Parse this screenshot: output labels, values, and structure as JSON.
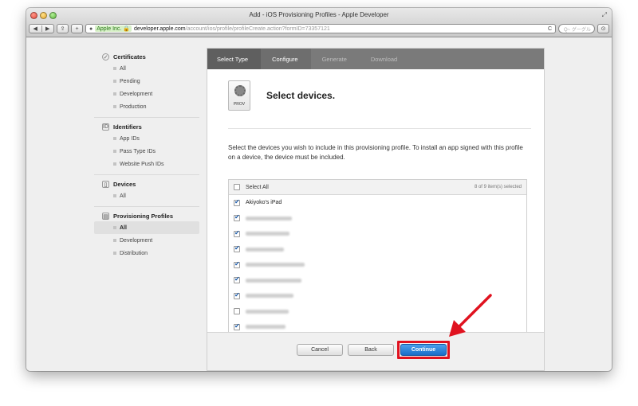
{
  "window": {
    "title": "Add - iOS Provisioning Profiles - Apple Developer",
    "fullscreen_glyph": "⤢"
  },
  "toolbar": {
    "back_glyph": "◀",
    "forward_glyph": "▶",
    "share_glyph": "⇪",
    "add_glyph": "+",
    "ev_badge": "Apple Inc. 🔒",
    "url_host": "developer.apple.com",
    "url_path": "/account/ios/profile/profileCreate.action?formID=73357121",
    "reload_glyph": "C",
    "search_placeholder": "Q~ グーグル",
    "download_glyph": "⊙"
  },
  "sidebar": {
    "sections": [
      {
        "title": "Certificates",
        "icon": "certificate-icon",
        "items": [
          "All",
          "Pending",
          "Development",
          "Production"
        ]
      },
      {
        "title": "Identifiers",
        "icon": "id-icon",
        "items": [
          "App IDs",
          "Pass Type IDs",
          "Website Push IDs"
        ]
      },
      {
        "title": "Devices",
        "icon": "device-icon",
        "items": [
          "All"
        ]
      },
      {
        "title": "Provisioning Profiles",
        "icon": "profile-icon",
        "items": [
          "All",
          "Development",
          "Distribution"
        ],
        "selected": "All"
      }
    ]
  },
  "steps": [
    "Select Type",
    "Configure",
    "Generate",
    "Download"
  ],
  "header": {
    "icon_label": "PROV",
    "title": "Select devices."
  },
  "description": "Select the devices you wish to include in this provisioning profile. To install an app signed with this profile on a device, the device must be included.",
  "devices": {
    "select_all_label": "Select All",
    "count_label": "8 of 9 item(s) selected",
    "rows": [
      {
        "name": "Akiyoko's iPad",
        "checked": true
      },
      {
        "name": "",
        "checked": true
      },
      {
        "name": "",
        "checked": true
      },
      {
        "name": "",
        "checked": true
      },
      {
        "name": "",
        "checked": true
      },
      {
        "name": "",
        "checked": true
      },
      {
        "name": "",
        "checked": true
      },
      {
        "name": "",
        "checked": false
      },
      {
        "name": "",
        "checked": true
      }
    ]
  },
  "footer": {
    "cancel_label": "Cancel",
    "back_label": "Back",
    "continue_label": "Continue"
  },
  "colors": {
    "annotation_red": "#e0121f",
    "primary_blue": "#1a6dc8"
  }
}
